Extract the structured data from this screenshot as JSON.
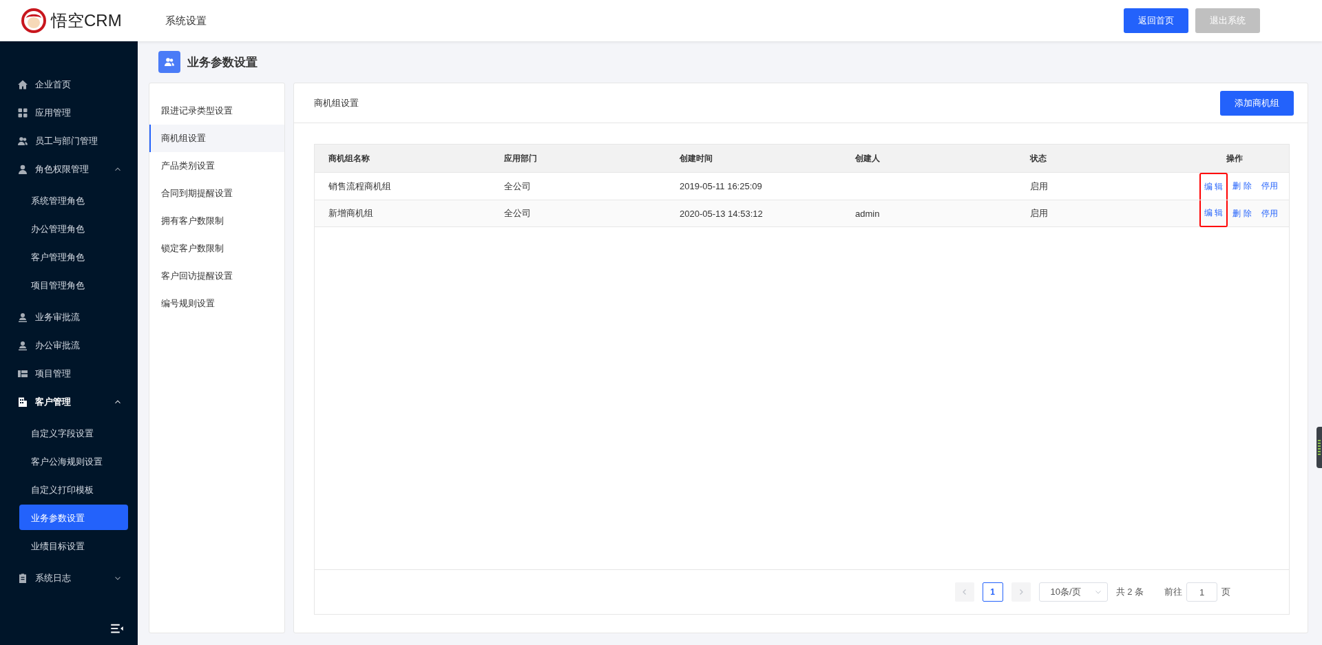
{
  "header": {
    "brand": "悟空CRM",
    "section": "系统设置",
    "buttons": [
      {
        "label": "返回首页",
        "kind": "primary"
      },
      {
        "label": "退出系统",
        "kind": "muted"
      }
    ]
  },
  "sidebar": {
    "items": [
      {
        "label": "企业首页",
        "selected": false
      },
      {
        "label": "应用管理",
        "selected": false
      },
      {
        "label": "员工与部门管理",
        "selected": false
      },
      {
        "label": "角色权限管理",
        "selected": false,
        "expanded": true,
        "children": [
          {
            "label": "系统管理角色",
            "selected": false
          },
          {
            "label": "办公管理角色",
            "selected": false
          },
          {
            "label": "客户管理角色",
            "selected": false
          },
          {
            "label": "项目管理角色",
            "selected": false
          }
        ]
      },
      {
        "label": "业务审批流",
        "selected": false
      },
      {
        "label": "办公审批流",
        "selected": false
      },
      {
        "label": "项目管理",
        "selected": false
      },
      {
        "label": "客户管理",
        "selected": false,
        "expanded": true,
        "children": [
          {
            "label": "自定义字段设置",
            "selected": false
          },
          {
            "label": "客户公海规则设置",
            "selected": false
          },
          {
            "label": "自定义打印模板",
            "selected": false
          },
          {
            "label": "业务参数设置",
            "selected": true
          },
          {
            "label": "业绩目标设置",
            "selected": false
          }
        ]
      },
      {
        "label": "系统日志",
        "selected": false,
        "expanded": false
      }
    ]
  },
  "page_title": "业务参数设置",
  "settings_menu": [
    {
      "label": "跟进记录类型设置",
      "selected": false
    },
    {
      "label": "商机组设置",
      "selected": true
    },
    {
      "label": "产品类别设置",
      "selected": false
    },
    {
      "label": "合同到期提醒设置",
      "selected": false
    },
    {
      "label": "拥有客户数限制",
      "selected": false
    },
    {
      "label": "锁定客户数限制",
      "selected": false
    },
    {
      "label": "客户回访提醒设置",
      "selected": false
    },
    {
      "label": "编号规则设置",
      "selected": false
    }
  ],
  "panel": {
    "title": "商机组设置",
    "add_button": "添加商机组"
  },
  "table": {
    "columns": [
      "商机组名称",
      "应用部门",
      "创建时间",
      "创建人",
      "状态",
      "操作"
    ],
    "rows": [
      {
        "cells": [
          "销售流程商机组",
          "全公司",
          "2019-05-11 16:25:09",
          "",
          "启用"
        ],
        "actions": [
          {
            "label": "编 辑",
            "highlighted": true
          },
          {
            "label": "删 除",
            "highlighted": false
          },
          {
            "label": "停用",
            "highlighted": false
          }
        ]
      },
      {
        "cells": [
          "新增商机组",
          "全公司",
          "2020-05-13 14:53:12",
          "admin",
          "启用"
        ],
        "actions": [
          {
            "label": "编 辑",
            "highlighted": true
          },
          {
            "label": "删 除",
            "highlighted": false
          },
          {
            "label": "停用",
            "highlighted": false
          }
        ]
      }
    ]
  },
  "pagination": {
    "prev_disabled": true,
    "next_disabled": true,
    "pages": [
      {
        "label": "1",
        "selected": true
      }
    ],
    "page_size": "10条/页",
    "total": "共 2 条",
    "jump_label": "前往",
    "jump_value": "1",
    "jump_suffix": "页"
  }
}
